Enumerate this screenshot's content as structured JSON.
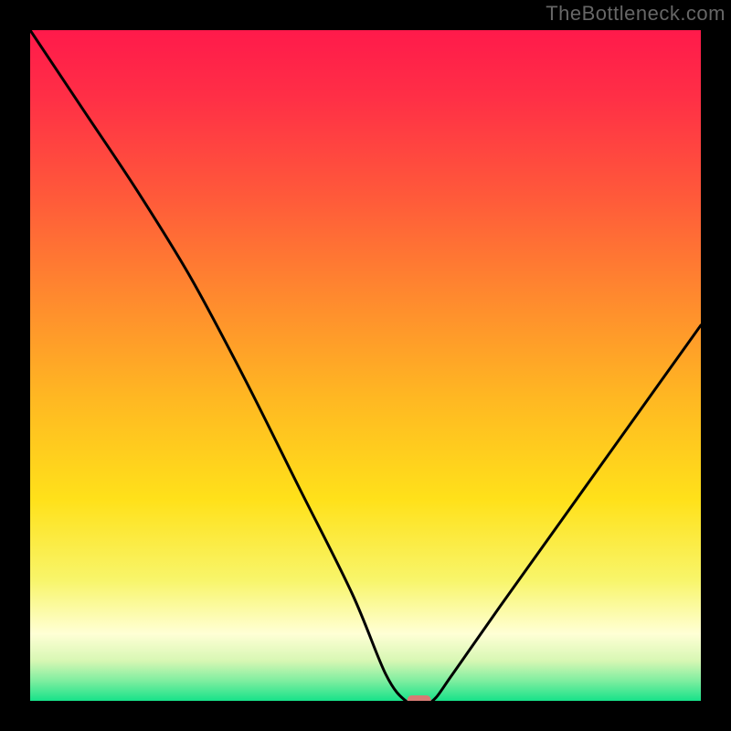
{
  "watermark": "TheBottleneck.com",
  "chart_data": {
    "type": "line",
    "title": "",
    "xlabel": "",
    "ylabel": "",
    "xlim": [
      0,
      100
    ],
    "ylim": [
      0,
      100
    ],
    "series": [
      {
        "name": "bottleneck-curve",
        "x": [
          0,
          8,
          16,
          24,
          32,
          40,
          48,
          53,
          56,
          58,
          60,
          63,
          70,
          80,
          90,
          100
        ],
        "values": [
          100,
          88,
          76,
          63,
          48,
          32,
          16,
          4,
          0,
          0,
          0,
          4,
          14,
          28,
          42,
          56
        ]
      }
    ],
    "marker": {
      "x": 58,
      "y": 0
    },
    "gradient_stops": [
      {
        "offset": 0.0,
        "color": "#ff1a4b"
      },
      {
        "offset": 0.1,
        "color": "#ff2f46"
      },
      {
        "offset": 0.25,
        "color": "#ff5a3a"
      },
      {
        "offset": 0.4,
        "color": "#ff8a2e"
      },
      {
        "offset": 0.55,
        "color": "#ffb822"
      },
      {
        "offset": 0.7,
        "color": "#ffe11a"
      },
      {
        "offset": 0.82,
        "color": "#f8f56a"
      },
      {
        "offset": 0.9,
        "color": "#ffffd5"
      },
      {
        "offset": 0.94,
        "color": "#d8f7b4"
      },
      {
        "offset": 0.97,
        "color": "#7feea0"
      },
      {
        "offset": 1.0,
        "color": "#17e28a"
      }
    ]
  }
}
